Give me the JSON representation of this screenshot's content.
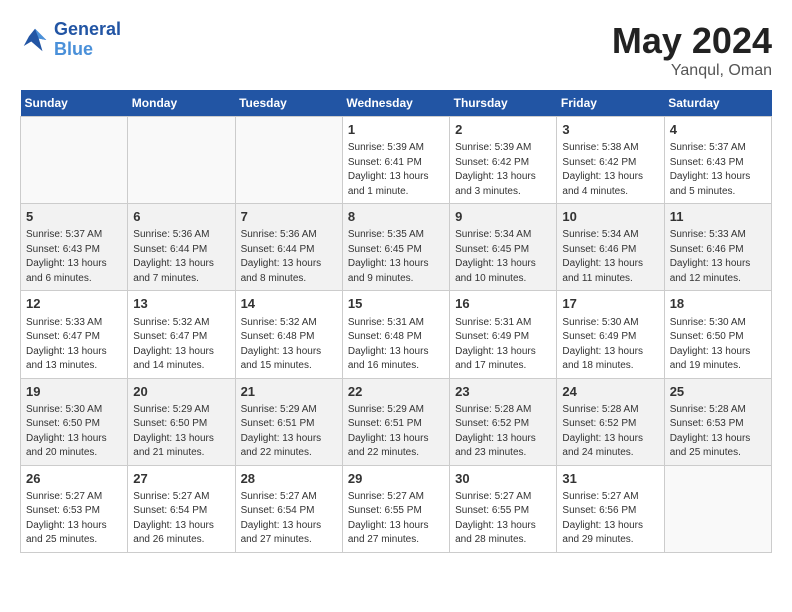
{
  "header": {
    "logo_line1": "General",
    "logo_line2": "Blue",
    "month_year": "May 2024",
    "location": "Yanqul, Oman"
  },
  "weekdays": [
    "Sunday",
    "Monday",
    "Tuesday",
    "Wednesday",
    "Thursday",
    "Friday",
    "Saturday"
  ],
  "weeks": [
    [
      {
        "day": "",
        "info": ""
      },
      {
        "day": "",
        "info": ""
      },
      {
        "day": "",
        "info": ""
      },
      {
        "day": "1",
        "info": "Sunrise: 5:39 AM\nSunset: 6:41 PM\nDaylight: 13 hours\nand 1 minute."
      },
      {
        "day": "2",
        "info": "Sunrise: 5:39 AM\nSunset: 6:42 PM\nDaylight: 13 hours\nand 3 minutes."
      },
      {
        "day": "3",
        "info": "Sunrise: 5:38 AM\nSunset: 6:42 PM\nDaylight: 13 hours\nand 4 minutes."
      },
      {
        "day": "4",
        "info": "Sunrise: 5:37 AM\nSunset: 6:43 PM\nDaylight: 13 hours\nand 5 minutes."
      }
    ],
    [
      {
        "day": "5",
        "info": "Sunrise: 5:37 AM\nSunset: 6:43 PM\nDaylight: 13 hours\nand 6 minutes."
      },
      {
        "day": "6",
        "info": "Sunrise: 5:36 AM\nSunset: 6:44 PM\nDaylight: 13 hours\nand 7 minutes."
      },
      {
        "day": "7",
        "info": "Sunrise: 5:36 AM\nSunset: 6:44 PM\nDaylight: 13 hours\nand 8 minutes."
      },
      {
        "day": "8",
        "info": "Sunrise: 5:35 AM\nSunset: 6:45 PM\nDaylight: 13 hours\nand 9 minutes."
      },
      {
        "day": "9",
        "info": "Sunrise: 5:34 AM\nSunset: 6:45 PM\nDaylight: 13 hours\nand 10 minutes."
      },
      {
        "day": "10",
        "info": "Sunrise: 5:34 AM\nSunset: 6:46 PM\nDaylight: 13 hours\nand 11 minutes."
      },
      {
        "day": "11",
        "info": "Sunrise: 5:33 AM\nSunset: 6:46 PM\nDaylight: 13 hours\nand 12 minutes."
      }
    ],
    [
      {
        "day": "12",
        "info": "Sunrise: 5:33 AM\nSunset: 6:47 PM\nDaylight: 13 hours\nand 13 minutes."
      },
      {
        "day": "13",
        "info": "Sunrise: 5:32 AM\nSunset: 6:47 PM\nDaylight: 13 hours\nand 14 minutes."
      },
      {
        "day": "14",
        "info": "Sunrise: 5:32 AM\nSunset: 6:48 PM\nDaylight: 13 hours\nand 15 minutes."
      },
      {
        "day": "15",
        "info": "Sunrise: 5:31 AM\nSunset: 6:48 PM\nDaylight: 13 hours\nand 16 minutes."
      },
      {
        "day": "16",
        "info": "Sunrise: 5:31 AM\nSunset: 6:49 PM\nDaylight: 13 hours\nand 17 minutes."
      },
      {
        "day": "17",
        "info": "Sunrise: 5:30 AM\nSunset: 6:49 PM\nDaylight: 13 hours\nand 18 minutes."
      },
      {
        "day": "18",
        "info": "Sunrise: 5:30 AM\nSunset: 6:50 PM\nDaylight: 13 hours\nand 19 minutes."
      }
    ],
    [
      {
        "day": "19",
        "info": "Sunrise: 5:30 AM\nSunset: 6:50 PM\nDaylight: 13 hours\nand 20 minutes."
      },
      {
        "day": "20",
        "info": "Sunrise: 5:29 AM\nSunset: 6:50 PM\nDaylight: 13 hours\nand 21 minutes."
      },
      {
        "day": "21",
        "info": "Sunrise: 5:29 AM\nSunset: 6:51 PM\nDaylight: 13 hours\nand 22 minutes."
      },
      {
        "day": "22",
        "info": "Sunrise: 5:29 AM\nSunset: 6:51 PM\nDaylight: 13 hours\nand 22 minutes."
      },
      {
        "day": "23",
        "info": "Sunrise: 5:28 AM\nSunset: 6:52 PM\nDaylight: 13 hours\nand 23 minutes."
      },
      {
        "day": "24",
        "info": "Sunrise: 5:28 AM\nSunset: 6:52 PM\nDaylight: 13 hours\nand 24 minutes."
      },
      {
        "day": "25",
        "info": "Sunrise: 5:28 AM\nSunset: 6:53 PM\nDaylight: 13 hours\nand 25 minutes."
      }
    ],
    [
      {
        "day": "26",
        "info": "Sunrise: 5:27 AM\nSunset: 6:53 PM\nDaylight: 13 hours\nand 25 minutes."
      },
      {
        "day": "27",
        "info": "Sunrise: 5:27 AM\nSunset: 6:54 PM\nDaylight: 13 hours\nand 26 minutes."
      },
      {
        "day": "28",
        "info": "Sunrise: 5:27 AM\nSunset: 6:54 PM\nDaylight: 13 hours\nand 27 minutes."
      },
      {
        "day": "29",
        "info": "Sunrise: 5:27 AM\nSunset: 6:55 PM\nDaylight: 13 hours\nand 27 minutes."
      },
      {
        "day": "30",
        "info": "Sunrise: 5:27 AM\nSunset: 6:55 PM\nDaylight: 13 hours\nand 28 minutes."
      },
      {
        "day": "31",
        "info": "Sunrise: 5:27 AM\nSunset: 6:56 PM\nDaylight: 13 hours\nand 29 minutes."
      },
      {
        "day": "",
        "info": ""
      }
    ]
  ]
}
